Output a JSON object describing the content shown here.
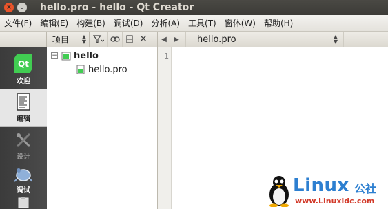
{
  "window": {
    "title": "hello.pro - hello - Qt Creator",
    "close_glyph": "×",
    "minimize_glyph": "⌄"
  },
  "menubar": {
    "items": [
      "文件(F)",
      "编辑(E)",
      "构建(B)",
      "调试(D)",
      "分析(A)",
      "工具(T)",
      "窗体(W)",
      "帮助(H)"
    ]
  },
  "modes": [
    {
      "label": "欢迎",
      "icon": "qt-logo-icon",
      "icon_text": "Qt",
      "state": "normal"
    },
    {
      "label": "编辑",
      "icon": "edit-document-icon",
      "state": "active"
    },
    {
      "label": "设计",
      "icon": "design-tools-icon",
      "state": "disabled"
    },
    {
      "label": "调试",
      "icon": "debug-bug-icon",
      "state": "normal"
    },
    {
      "label": "",
      "icon": "projects-icon",
      "state": "normal"
    }
  ],
  "project_panel": {
    "view_selector": "项目",
    "toolbar": [
      "filter-icon",
      "link-icon",
      "split-icon",
      "close-icon"
    ],
    "tree": {
      "project": "hello",
      "expander": "−",
      "files": [
        "hello.pro"
      ]
    }
  },
  "editor": {
    "current_file": "hello.pro",
    "line_numbers": [
      "1"
    ]
  },
  "watermark": {
    "brand": "Linux",
    "brand_suffix": "公社",
    "url": "www.Linuxidc.com"
  },
  "colors": {
    "title_bg": "#3c3b37",
    "close_button": "#e9542a",
    "qt_green": "#41cd52",
    "watermark_blue": "#2d7fd0"
  }
}
